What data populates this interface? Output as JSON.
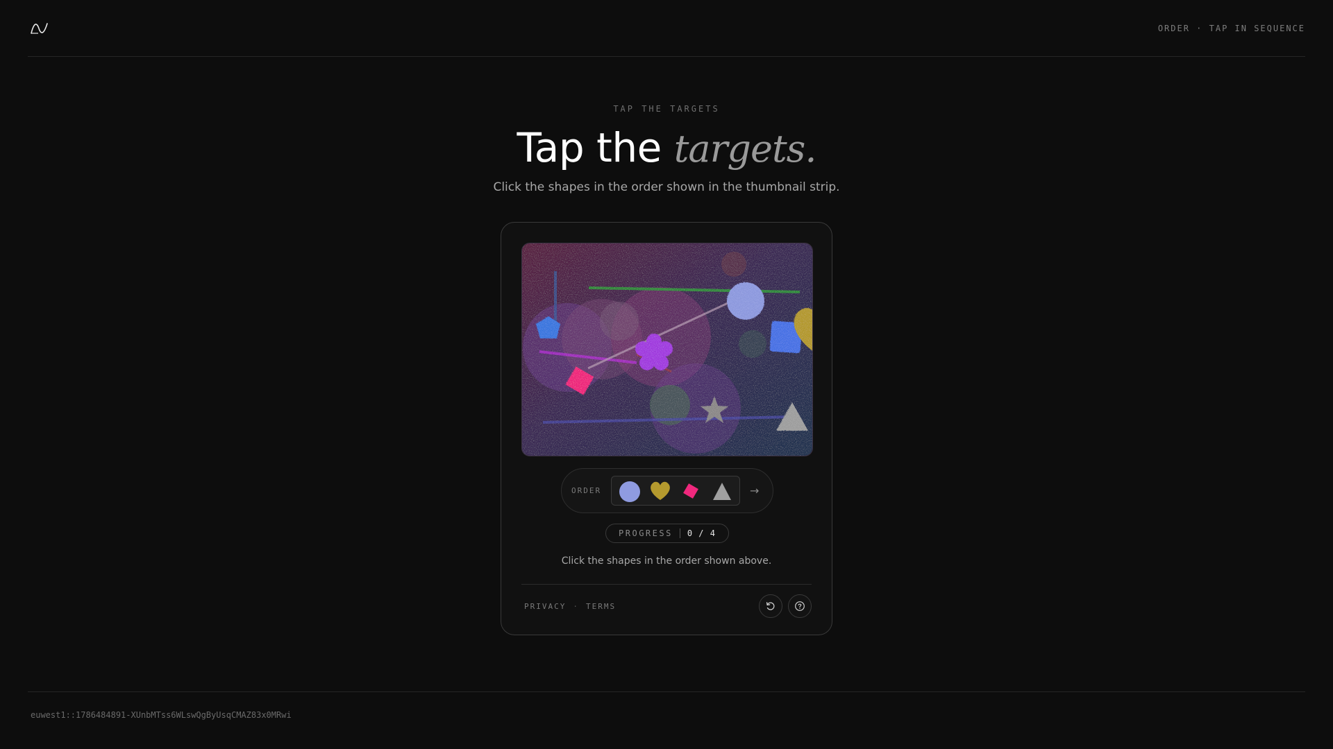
{
  "header": {
    "mode_label": "ORDER · TAP IN SEQUENCE",
    "logo_icon": "wave-logo-icon"
  },
  "hero": {
    "eyebrow": "TAP THE TARGETS",
    "title_main": "Tap the ",
    "title_accent": "targets.",
    "subtitle": "Click the shapes in the order shown in the thumbnail strip."
  },
  "challenge": {
    "order_label": "ORDER",
    "order_sequence": [
      {
        "shape": "circle",
        "color": "#8f9be0"
      },
      {
        "shape": "heart",
        "color": "#b59a2e"
      },
      {
        "shape": "diamond",
        "color": "#f0287d"
      },
      {
        "shape": "triangle",
        "color": "#a0a0a0"
      }
    ],
    "progress": {
      "label": "PROGRESS",
      "value": "0 / 4",
      "current": 0,
      "total": 4
    },
    "instruction": "Click the shapes in the order shown above.",
    "links": {
      "privacy": "PRIVACY",
      "separator": "·",
      "terms": "TERMS"
    },
    "buttons": {
      "refresh_icon": "refresh-icon",
      "help_icon": "help-icon"
    }
  },
  "footer": {
    "session_id": "euwest1::1786484891-XUnbMTss6WLswQgByUsqCMAZ83x0MRwi"
  },
  "colors": {
    "background": "#0d0d0d",
    "card_border": "#3a3a3a",
    "accent_text": "#9a9a9a"
  }
}
